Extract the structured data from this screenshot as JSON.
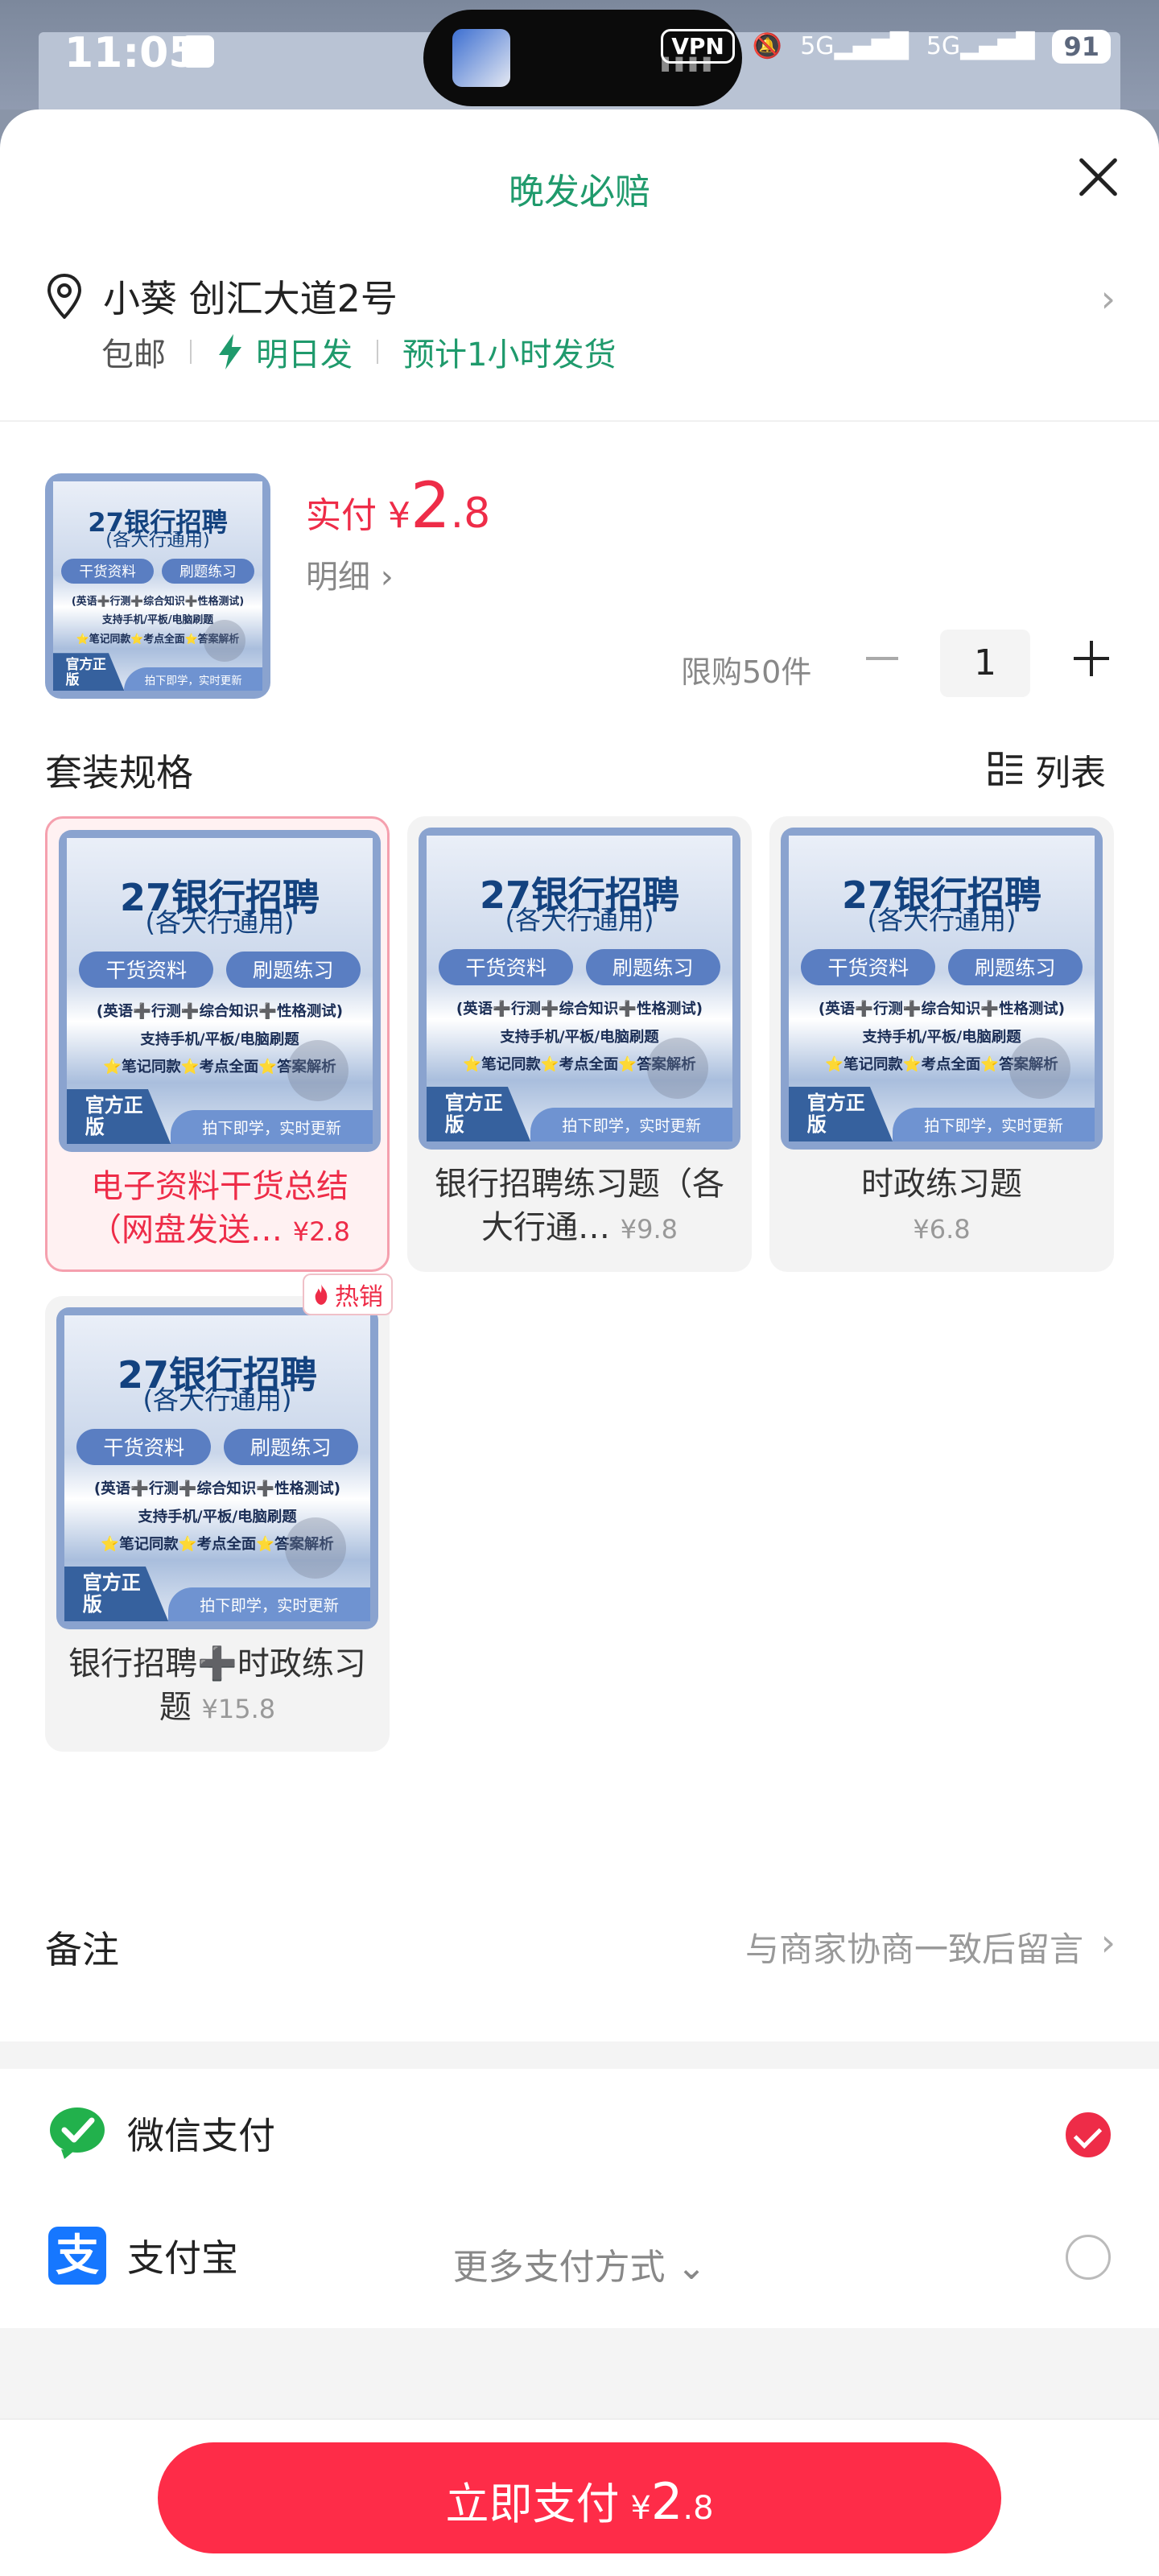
{
  "status_bar": {
    "time": "11:05",
    "vpn": "VPN",
    "net1": "5G",
    "net2": "5G",
    "battery": "91"
  },
  "sheet": {
    "title": "晚发必赔"
  },
  "address": {
    "text": "小葵 创汇大道2号"
  },
  "shipping": {
    "free": "包邮",
    "next_day": "明日发",
    "eta": "预计1小时发货"
  },
  "product": {
    "price_label": "实付",
    "yen": "¥",
    "price_int": "2",
    "price_dec": ".8",
    "detail": "明细",
    "limit": "限购50件",
    "quantity": "1"
  },
  "cover": {
    "title": "27银行招聘",
    "subtitle": "(各大行通用)",
    "tag1": "干货资料",
    "tag2": "刷题练习",
    "line1": "(英语➕行测➕综合知识➕性格测试)",
    "line2": "支持手机/平板/电脑刷题",
    "line3": "⭐笔记同款⭐考点全面⭐答案解析",
    "stamp": "官方正版",
    "footer": "拍下即学，实时更新"
  },
  "spec": {
    "title": "套装规格",
    "list_label": "列表",
    "options": [
      {
        "name": "电子资料干货总结（网盘发送…",
        "price": "¥2.8",
        "selected": true
      },
      {
        "name": "银行招聘练习题（各大行通…",
        "price": "¥9.8"
      },
      {
        "name": "时政练习题",
        "price": "¥6.8"
      },
      {
        "name": "银行招聘➕时政练习题",
        "price": "¥15.8",
        "badge": "热销"
      }
    ]
  },
  "remark": {
    "label": "备注",
    "placeholder": "与商家协商一致后留言"
  },
  "payment": {
    "wechat": "微信支付",
    "alipay": "支付宝",
    "alipay_glyph": "支",
    "more": "更多支付方式"
  },
  "submit": {
    "label": "立即支付",
    "yen": "¥",
    "int": "2",
    "dec": ".8"
  },
  "colors": {
    "accent": "#fe2c48",
    "green": "#1f9a6c"
  }
}
